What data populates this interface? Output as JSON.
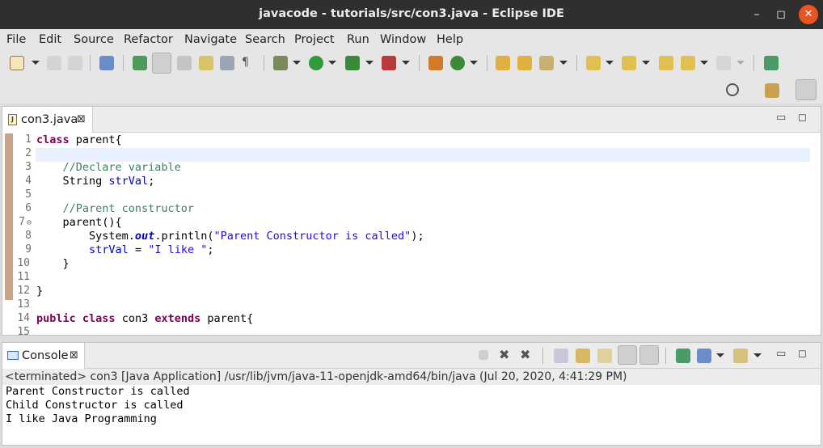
{
  "window": {
    "title": "javacode - tutorials/src/con3.java - Eclipse IDE",
    "min_label": "–",
    "max_label": "◻",
    "close_label": "✕"
  },
  "menu": [
    "File",
    "Edit",
    "Source",
    "Refactor",
    "Navigate",
    "Search",
    "Project",
    "Run",
    "Window",
    "Help"
  ],
  "colors": {
    "titlebar": "#2f2f2f",
    "close_button": "#e95420",
    "keyword": "#7f0055",
    "comment": "#3f7f5f",
    "string": "#2a00ff",
    "field": "#0000c0"
  },
  "editor": {
    "tab_label": "con3.java",
    "tab_close": "⊠",
    "file_icon_letter": "J",
    "line_numbers": [
      "1",
      "2",
      "3",
      "4",
      "5",
      "6",
      "7",
      "8",
      "9",
      "10",
      "11",
      "12",
      "13",
      "14",
      "15"
    ],
    "lines": [
      {
        "kw1": "class",
        "rest": " parent{"
      },
      {},
      {
        "comment": "    //Declare variable"
      },
      {
        "plain": "    String ",
        "field": "strVal",
        "after": ";"
      },
      {},
      {
        "comment": "    //Parent constructor"
      },
      {
        "plain": "    parent(){"
      },
      {
        "plain": "        System.",
        "static_field": "out",
        "mid": ".println(",
        "string": "\"Parent Constructor is called\"",
        "after": ");"
      },
      {
        "plain": "        ",
        "field": "strVal",
        "mid": " = ",
        "string": "\"I like \"",
        "after": ";"
      },
      {
        "plain": "    }"
      },
      {},
      {
        "plain": "}"
      },
      {},
      {
        "kw1": "public",
        "sp1": " ",
        "kw2": "class",
        "mid": " con3 ",
        "kw3": "extends",
        "after": " parent{"
      }
    ]
  },
  "console": {
    "tab_label": "Console",
    "tab_close": "⊠",
    "status": "<terminated> con3 [Java Application] /usr/lib/jvm/java-11-openjdk-amd64/bin/java (Jul 20, 2020, 4:41:29 PM)",
    "output": [
      "Parent Constructor is called",
      "Child Constructor is called",
      "I like Java Programming"
    ]
  },
  "panel_buttons": {
    "minimize": "▭",
    "maximize": "◻"
  }
}
